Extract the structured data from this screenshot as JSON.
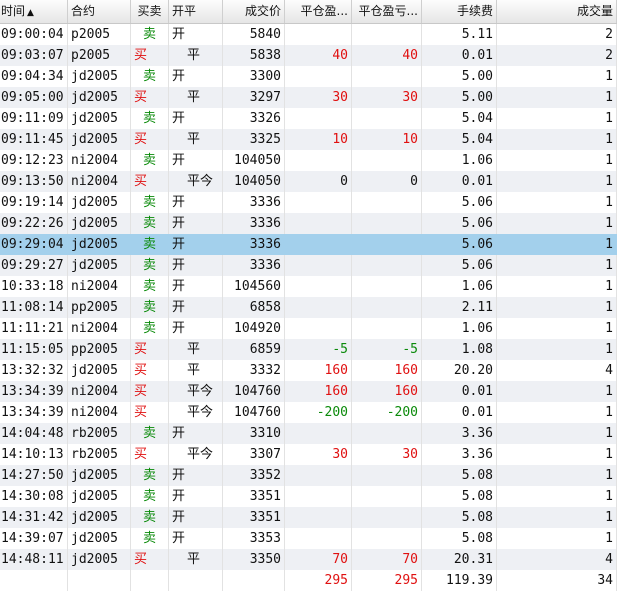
{
  "columns": [
    "时间",
    "合约",
    "买卖",
    "开平",
    "成交价",
    "平仓盈...",
    "平仓盈亏...",
    "手续费",
    "成交量"
  ],
  "sort_indicator": "▲",
  "selected_row": 10,
  "rows": [
    [
      "09:00:04",
      "p2005",
      "卖",
      "开",
      "5840",
      "",
      "",
      "5.11",
      "2"
    ],
    [
      "09:03:07",
      "p2005",
      "买",
      "平",
      "5838",
      "40",
      "40",
      "0.01",
      "2"
    ],
    [
      "09:04:34",
      "jd2005",
      "卖",
      "开",
      "3300",
      "",
      "",
      "5.00",
      "1"
    ],
    [
      "09:05:00",
      "jd2005",
      "买",
      "平",
      "3297",
      "30",
      "30",
      "5.00",
      "1"
    ],
    [
      "09:11:09",
      "jd2005",
      "卖",
      "开",
      "3326",
      "",
      "",
      "5.04",
      "1"
    ],
    [
      "09:11:45",
      "jd2005",
      "买",
      "平",
      "3325",
      "10",
      "10",
      "5.04",
      "1"
    ],
    [
      "09:12:23",
      "ni2004",
      "卖",
      "开",
      "104050",
      "",
      "",
      "1.06",
      "1"
    ],
    [
      "09:13:50",
      "ni2004",
      "买",
      "平今",
      "104050",
      "0",
      "0",
      "0.01",
      "1"
    ],
    [
      "09:19:14",
      "jd2005",
      "卖",
      "开",
      "3336",
      "",
      "",
      "5.06",
      "1"
    ],
    [
      "09:22:26",
      "jd2005",
      "卖",
      "开",
      "3336",
      "",
      "",
      "5.06",
      "1"
    ],
    [
      "09:29:04",
      "jd2005",
      "卖",
      "开",
      "3336",
      "",
      "",
      "5.06",
      "1"
    ],
    [
      "09:29:27",
      "jd2005",
      "卖",
      "开",
      "3336",
      "",
      "",
      "5.06",
      "1"
    ],
    [
      "10:33:18",
      "ni2004",
      "卖",
      "开",
      "104560",
      "",
      "",
      "1.06",
      "1"
    ],
    [
      "11:08:14",
      "pp2005",
      "卖",
      "开",
      "6858",
      "",
      "",
      "2.11",
      "1"
    ],
    [
      "11:11:21",
      "ni2004",
      "卖",
      "开",
      "104920",
      "",
      "",
      "1.06",
      "1"
    ],
    [
      "11:15:05",
      "pp2005",
      "买",
      "平",
      "6859",
      "-5",
      "-5",
      "1.08",
      "1"
    ],
    [
      "13:32:32",
      "jd2005",
      "买",
      "平",
      "3332",
      "160",
      "160",
      "20.20",
      "4"
    ],
    [
      "13:34:39",
      "ni2004",
      "买",
      "平今",
      "104760",
      "160",
      "160",
      "0.01",
      "1"
    ],
    [
      "13:34:39",
      "ni2004",
      "买",
      "平今",
      "104760",
      "-200",
      "-200",
      "0.01",
      "1"
    ],
    [
      "14:04:48",
      "rb2005",
      "卖",
      "开",
      "3310",
      "",
      "",
      "3.36",
      "1"
    ],
    [
      "14:10:13",
      "rb2005",
      "买",
      "平今",
      "3307",
      "30",
      "30",
      "3.36",
      "1"
    ],
    [
      "14:27:50",
      "jd2005",
      "卖",
      "开",
      "3352",
      "",
      "",
      "5.08",
      "1"
    ],
    [
      "14:30:08",
      "jd2005",
      "卖",
      "开",
      "3351",
      "",
      "",
      "5.08",
      "1"
    ],
    [
      "14:31:42",
      "jd2005",
      "卖",
      "开",
      "3351",
      "",
      "",
      "5.08",
      "1"
    ],
    [
      "14:39:07",
      "jd2005",
      "卖",
      "开",
      "3353",
      "",
      "",
      "5.08",
      "1"
    ],
    [
      "14:48:11",
      "jd2005",
      "买",
      "平",
      "3350",
      "70",
      "70",
      "20.31",
      "4"
    ]
  ],
  "totals": [
    "",
    "",
    "",
    "",
    "",
    "295",
    "295",
    "119.39",
    "34"
  ],
  "colors": {
    "buy": "#e01010",
    "sell": "#0a8a0a",
    "profit": "#e01010",
    "loss": "#0a8a0a",
    "selected": "#a3d0ec",
    "alt_row": "#eef0f4"
  }
}
